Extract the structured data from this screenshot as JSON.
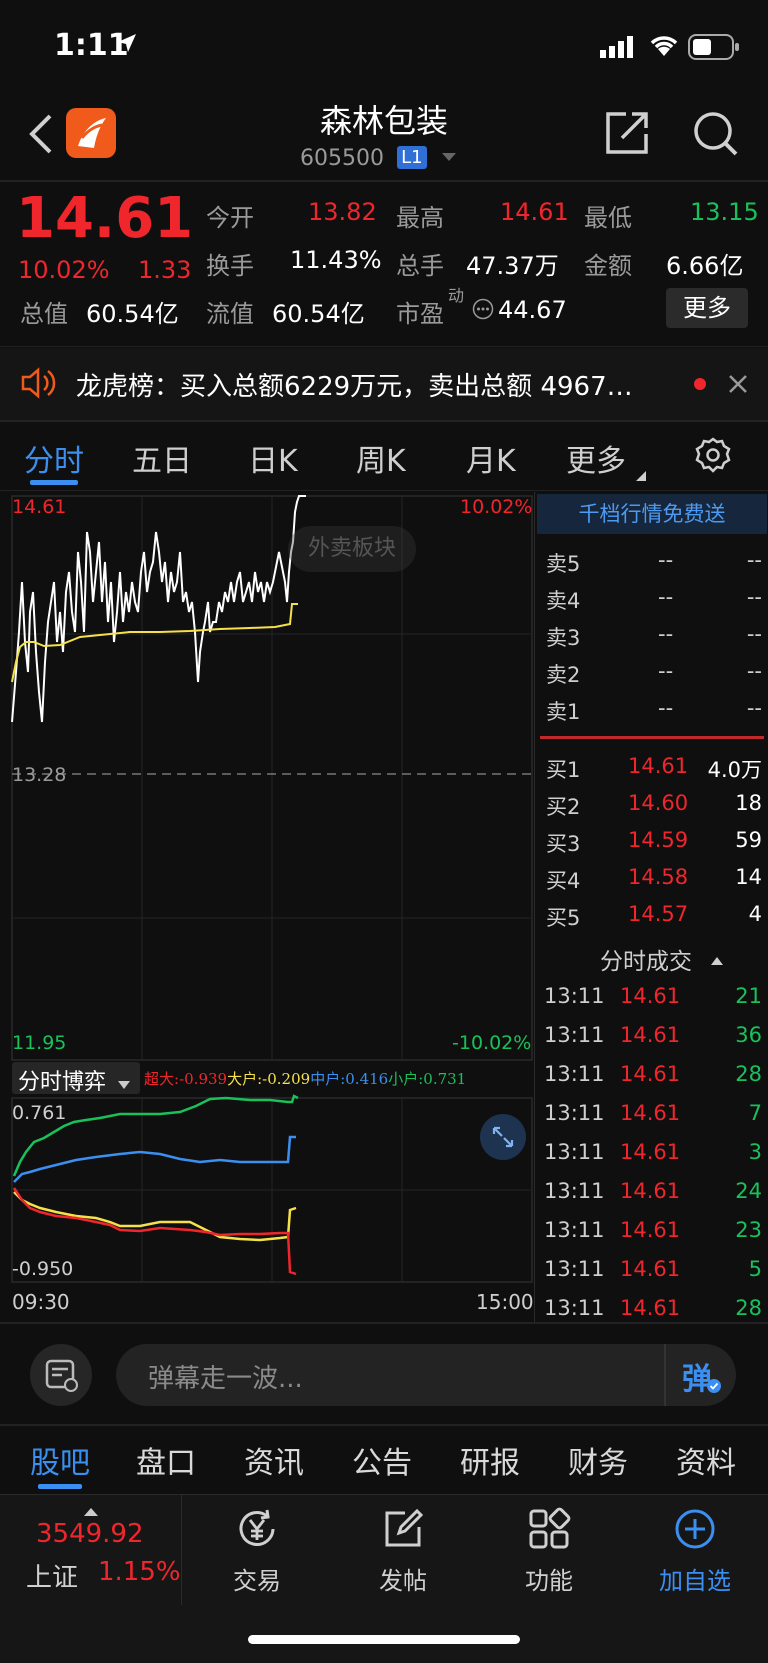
{
  "status": {
    "time": "1:11"
  },
  "header": {
    "title": "森林包装",
    "code": "605500",
    "level": "L1"
  },
  "quote": {
    "price": "14.61",
    "pct": "10.02%",
    "change": "1.33",
    "open_label": "今开",
    "open": "13.82",
    "high_label": "最高",
    "high": "14.61",
    "low_label": "最低",
    "low": "13.15",
    "turnover_label": "换手",
    "turnover": "11.43%",
    "volume_label": "总手",
    "volume": "47.37万",
    "amount_label": "金额",
    "amount": "6.66亿",
    "mcap_label": "总值",
    "mcap": "60.54亿",
    "float_label": "流值",
    "float": "60.54亿",
    "pe_label": "市盈",
    "pe_sup": "动",
    "pe": "44.67",
    "more": "更多"
  },
  "notice": {
    "label": "龙虎榜",
    "text": "：买入总额6229万元，卖出总额 4967…"
  },
  "tabs": [
    "分时",
    "五日",
    "日K",
    "周K",
    "月K",
    "更多"
  ],
  "chart": {
    "top_price": "14.61",
    "top_pct": "10.02%",
    "mid_price": "13.28",
    "bottom_price": "11.95",
    "bottom_pct": "-10.02%",
    "watermark": "外卖板块",
    "flow_select": "分时博弈",
    "flow_labels": [
      {
        "name": "超大",
        "value": ":-0.939",
        "color": "#f0262d"
      },
      {
        "name": "大户",
        "value": ":-0.209",
        "color": "#f5e14a"
      },
      {
        "name": "中户",
        "value": ":0.416",
        "color": "#3b8ff0"
      },
      {
        "name": "小户",
        "value": ":0.731",
        "color": "#19c15a"
      }
    ],
    "flow_top": "0.761",
    "flow_bottom": "-0.950",
    "time_start": "09:30",
    "time_end": "15:00"
  },
  "orderbook": {
    "promo": "千档行情免费送",
    "asks": [
      {
        "label": "卖5",
        "price": "--",
        "vol": "--"
      },
      {
        "label": "卖4",
        "price": "--",
        "vol": "--"
      },
      {
        "label": "卖3",
        "price": "--",
        "vol": "--"
      },
      {
        "label": "卖2",
        "price": "--",
        "vol": "--"
      },
      {
        "label": "卖1",
        "price": "--",
        "vol": "--"
      }
    ],
    "bids": [
      {
        "label": "买1",
        "price": "14.61",
        "vol": "4.0万"
      },
      {
        "label": "买2",
        "price": "14.60",
        "vol": "18"
      },
      {
        "label": "买3",
        "price": "14.59",
        "vol": "59"
      },
      {
        "label": "买4",
        "price": "14.58",
        "vol": "14"
      },
      {
        "label": "买5",
        "price": "14.57",
        "vol": "4"
      }
    ]
  },
  "trades": {
    "title": "分时成交",
    "rows": [
      {
        "time": "13:11",
        "price": "14.61",
        "vol": "21"
      },
      {
        "time": "13:11",
        "price": "14.61",
        "vol": "36"
      },
      {
        "time": "13:11",
        "price": "14.61",
        "vol": "28"
      },
      {
        "time": "13:11",
        "price": "14.61",
        "vol": "7"
      },
      {
        "time": "13:11",
        "price": "14.61",
        "vol": "3"
      },
      {
        "time": "13:11",
        "price": "14.61",
        "vol": "24"
      },
      {
        "time": "13:11",
        "price": "14.61",
        "vol": "23"
      },
      {
        "time": "13:11",
        "price": "14.61",
        "vol": "5"
      },
      {
        "time": "13:11",
        "price": "14.61",
        "vol": "28"
      }
    ]
  },
  "danmu": {
    "placeholder": "弹幕走一波...",
    "send": "弹"
  },
  "bottom_tabs": [
    "股吧",
    "盘口",
    "资讯",
    "公告",
    "研报",
    "财务",
    "资料"
  ],
  "nav": {
    "index_value": "3549.92",
    "index_name": "上证",
    "index_pct": "1.15%",
    "items": [
      "交易",
      "发帖",
      "功能",
      "加自选"
    ]
  },
  "colors": {
    "up": "#f0262d",
    "down": "#19c15a",
    "accent": "#3b8ff0",
    "bg": "#0f0f0f"
  }
}
